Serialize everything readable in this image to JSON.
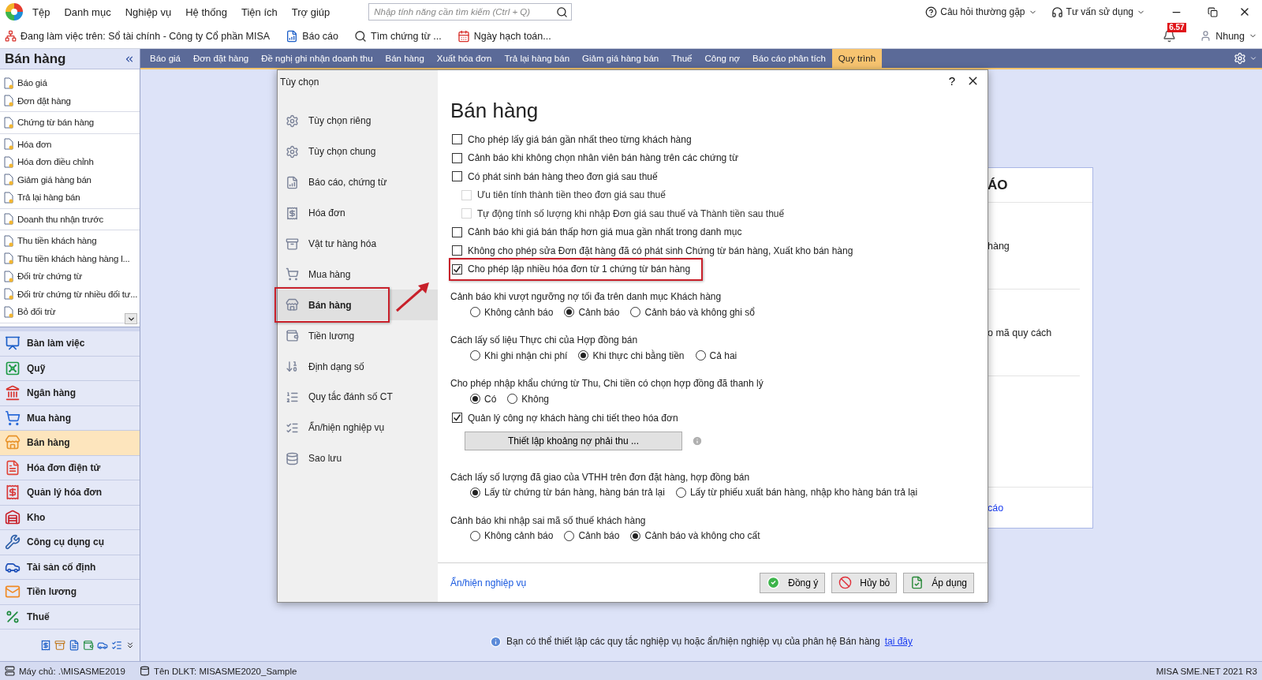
{
  "menu_bar": {
    "items": [
      "Tệp",
      "Danh mục",
      "Nghiệp vụ",
      "Hệ thống",
      "Tiện ích",
      "Trợ giúp"
    ],
    "search": {
      "placeholder": "Nhập tính năng cần tìm kiếm (Ctrl + Q)"
    },
    "help": "Câu hỏi thường gặp",
    "support": "Tư vấn sử dụng"
  },
  "toolbar": {
    "workspace": "Đang làm việc trên: Sổ tài chính - Công ty Cổ phần MISA",
    "items": [
      "Báo cáo",
      "Tìm chứng từ ...",
      "Ngày hạch toán..."
    ],
    "notification_count": "6.57",
    "user": "Nhung"
  },
  "sidebar": {
    "title": "Bán hàng",
    "groups": [
      {
        "items": [
          "Báo giá",
          "Đơn đặt hàng"
        ]
      },
      {
        "items": [
          "Chứng từ bán hàng"
        ]
      },
      {
        "items": [
          "Hóa đơn",
          "Hóa đơn điều chỉnh",
          "Giảm giá hàng bán",
          "Trả lại hàng bán"
        ]
      },
      {
        "items": [
          "Doanh thu nhận trước"
        ]
      },
      {
        "items": [
          "Thu tiền khách hàng",
          "Thu tiền khách hàng hàng l...",
          "Đối trừ chứng từ",
          "Đối trừ chứng từ nhiều đối tư...",
          "Bỏ đối trừ"
        ]
      }
    ]
  },
  "modules": [
    {
      "label": "Bàn làm việc",
      "selected": false
    },
    {
      "label": "Quỹ",
      "selected": false
    },
    {
      "label": "Ngân hàng",
      "selected": false
    },
    {
      "label": "Mua hàng",
      "selected": false
    },
    {
      "label": "Bán hàng",
      "selected": true
    },
    {
      "label": "Hóa đơn điện tử",
      "selected": false
    },
    {
      "label": "Quản lý hóa đơn",
      "selected": false
    },
    {
      "label": "Kho",
      "selected": false
    },
    {
      "label": "Công cụ dụng cụ",
      "selected": false
    },
    {
      "label": "Tài sản cố định",
      "selected": false
    },
    {
      "label": "Tiền lương",
      "selected": false
    },
    {
      "label": "Thuế",
      "selected": false
    }
  ],
  "tabs": [
    {
      "label": "Báo giá",
      "selected": false
    },
    {
      "label": "Đơn đặt hàng",
      "selected": false
    },
    {
      "label": "Đề nghị ghi nhận doanh thu",
      "selected": false
    },
    {
      "label": "Bán hàng",
      "selected": false
    },
    {
      "label": "Xuất hóa đơn",
      "selected": false
    },
    {
      "label": "Trả lại hàng bán",
      "selected": false
    },
    {
      "label": "Giảm giá hàng bán",
      "selected": false
    },
    {
      "label": "Thuế",
      "selected": false
    },
    {
      "label": "Công nợ",
      "selected": false
    },
    {
      "label": "Báo cáo phân tích",
      "selected": false
    },
    {
      "label": "Quy trình",
      "selected": true
    }
  ],
  "card": {
    "title": "ÁO",
    "rows": [
      "hàng",
      "o mã quy cách"
    ],
    "link": "cáo"
  },
  "info": {
    "text": "Bạn có thể thiết lập các quy tắc nghiệp vụ hoặc ẩn/hiện nghiệp vụ của phân hệ Bán hàng",
    "link": "tại đây"
  },
  "dialog": {
    "title": "Tùy chọn",
    "help": "?",
    "heading": "Bán  hàng",
    "nav": [
      {
        "label": "Tùy chọn riêng",
        "selected": false,
        "highlighted": false
      },
      {
        "label": "Tùy chọn chung",
        "selected": false,
        "highlighted": false
      },
      {
        "label": "Báo cáo, chứng từ",
        "selected": false,
        "highlighted": false
      },
      {
        "label": "Hóa đơn",
        "selected": false,
        "highlighted": false
      },
      {
        "label": "Vật tư hàng hóa",
        "selected": false,
        "highlighted": false
      },
      {
        "label": "Mua hàng",
        "selected": false,
        "highlighted": false
      },
      {
        "label": "Bán hàng",
        "selected": true,
        "highlighted": true
      },
      {
        "label": "Tiền lương",
        "selected": false,
        "highlighted": false
      },
      {
        "label": "Định dạng số",
        "selected": false,
        "highlighted": false
      },
      {
        "label": "Quy tắc đánh số CT",
        "selected": false,
        "highlighted": false
      },
      {
        "label": "Ẩn/hiện nghiệp vụ",
        "selected": false,
        "highlighted": false
      },
      {
        "label": "Sao lưu",
        "selected": false,
        "highlighted": false
      }
    ],
    "options": [
      {
        "kind": "checkbox",
        "label": "Cho phép lấy giá bán gần nhất theo từng khách hàng",
        "checked": false,
        "highlighted": false
      },
      {
        "kind": "checkbox",
        "label": "Cảnh báo khi không chọn nhân viên bán hàng trên các chứng từ",
        "checked": false,
        "highlighted": false
      },
      {
        "kind": "checkbox",
        "label": "Có phát sinh bán hàng theo đơn giá sau thuế",
        "checked": false,
        "highlighted": false,
        "children": [
          {
            "label": "Ưu tiên tính thành tiền theo đơn giá sau thuế",
            "checked": false,
            "disabled": true
          },
          {
            "label": "Tự động tính số lượng khi nhập Đơn giá sau thuế và Thành tiền sau thuế",
            "checked": false,
            "disabled": true
          }
        ]
      },
      {
        "kind": "checkbox",
        "label": "Cảnh báo khi giá bán thấp hơn giá mua gần nhất trong danh mục",
        "checked": false,
        "highlighted": false
      },
      {
        "kind": "checkbox",
        "label": "Không cho phép sửa Đơn đặt hàng đã có phát sinh Chứng từ bán hàng, Xuất kho bán hàng",
        "checked": false,
        "highlighted": false
      },
      {
        "kind": "checkbox",
        "label": "Cho phép lập nhiều hóa đơn từ 1 chứng từ bán hàng",
        "checked": true,
        "highlighted": true
      },
      {
        "kind": "radio",
        "label": "Cảnh báo khi vượt ngưỡng nợ tối đa trên danh mục Khách hàng",
        "choices": [
          {
            "label": "Không cảnh báo",
            "selected": false
          },
          {
            "label": "Cảnh báo",
            "selected": true
          },
          {
            "label": "Cảnh báo và không ghi sổ",
            "selected": false
          }
        ]
      },
      {
        "kind": "radio",
        "label": "Cách lấy số liệu Thực chi của Hợp đồng bán",
        "choices": [
          {
            "label": "Khi ghi nhận chi phí",
            "selected": false
          },
          {
            "label": "Khi thực chi bằng tiền",
            "selected": true
          },
          {
            "label": "Cả hai",
            "selected": false
          }
        ]
      },
      {
        "kind": "radio",
        "label": "Cho phép nhập khẩu chứng từ Thu, Chi tiền có chọn hợp đồng đã thanh lý",
        "choices": [
          {
            "label": "Có",
            "selected": true
          },
          {
            "label": "Không",
            "selected": false
          }
        ]
      },
      {
        "kind": "checkbox",
        "label": "Quản lý công nợ khách hàng chi tiết theo hóa đơn",
        "checked": true,
        "highlighted": false
      },
      {
        "kind": "button",
        "label": "Thiết lập khoảng nợ phải thu ..."
      },
      {
        "kind": "radio",
        "label": "Cách lấy số lượng đã giao của VTHH trên đơn đặt hàng, hợp đồng bán",
        "choices": [
          {
            "label": "Lấy từ chứng từ bán hàng, hàng bán trả lại",
            "selected": true
          },
          {
            "label": "Lấy từ phiếu xuất bán hàng, nhập kho hàng bán trả lại",
            "selected": false
          }
        ]
      },
      {
        "kind": "radio",
        "label": "Cảnh báo khi nhập sai mã số thuế khách hàng",
        "choices": [
          {
            "label": "Không cảnh báo",
            "selected": false
          },
          {
            "label": "Cảnh báo",
            "selected": false
          },
          {
            "label": "Cảnh báo và không cho cất",
            "selected": true
          }
        ]
      }
    ],
    "footer_link": "Ẩn/hiện nghiệp vụ",
    "buttons": [
      {
        "kind": "ok",
        "label": "Đồng ý"
      },
      {
        "kind": "cancel",
        "label": "Hủy bỏ"
      },
      {
        "kind": "apply",
        "label": "Áp dụng"
      }
    ]
  },
  "status_bar": {
    "server": "Máy chủ: .\\MISASME2019",
    "database": "Tên DLKT: MISASME2020_Sample",
    "version": "MISA SME.NET 2021 R3"
  }
}
